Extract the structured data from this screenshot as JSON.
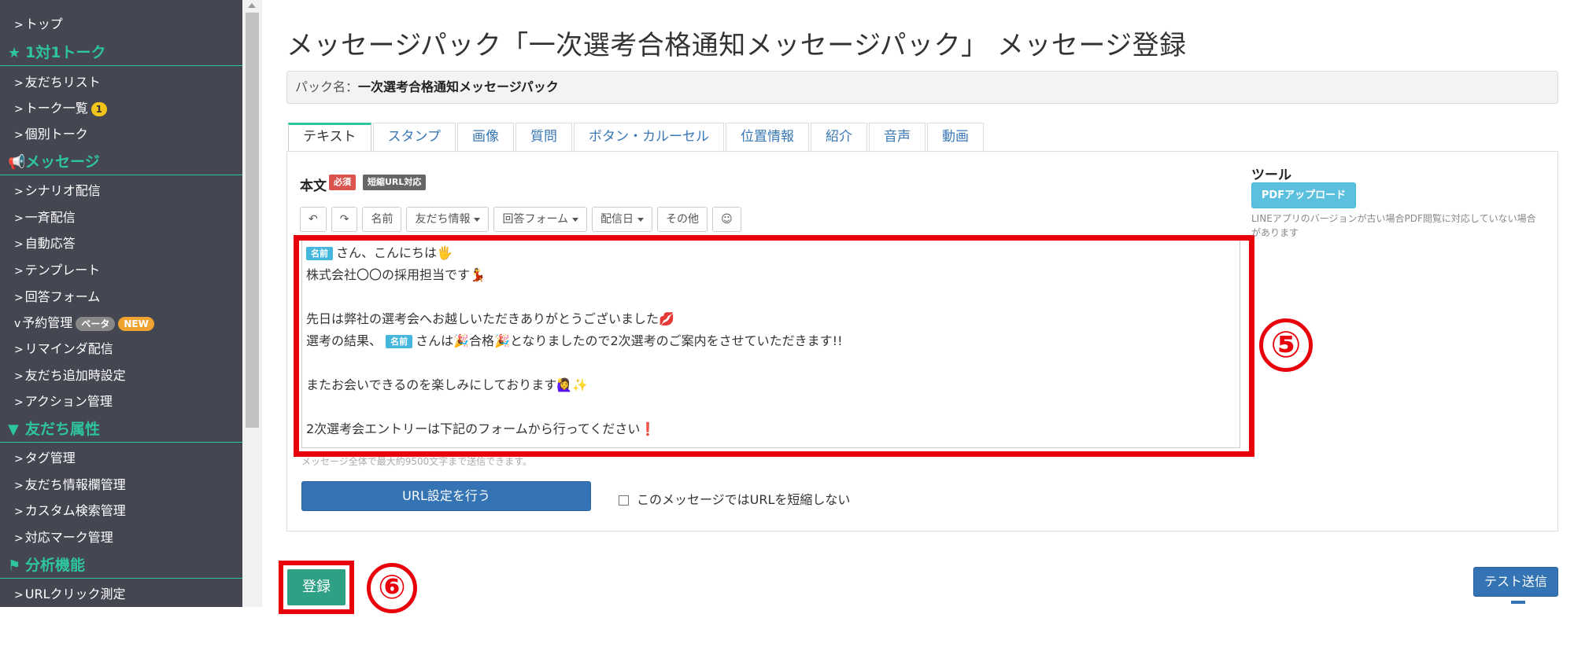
{
  "sidebar": {
    "top": "トップ",
    "talk_head": "1対1トーク",
    "friend_list": "友だちリスト",
    "talk_list": "トーク一覧",
    "talk_badge": "1",
    "individual_talk": "個別トーク",
    "message_head": "メッセージ",
    "scenario": "シナリオ配信",
    "broadcast": "一斉配信",
    "auto_reply": "自動応答",
    "template": "テンプレート",
    "answer_form": "回答フォーム",
    "reservation": "予約管理",
    "beta_badge": "ベータ",
    "new_badge": "NEW",
    "reminder": "リマインダ配信",
    "friend_add": "友だち追加時設定",
    "action": "アクション管理",
    "attr_head": "友だち属性",
    "tag": "タグ管理",
    "friend_info": "友だち情報欄管理",
    "custom_search": "カスタム検索管理",
    "mark": "対応マーク管理",
    "analysis_head": "分析機能",
    "url_click": "URLクリック測定"
  },
  "page": {
    "title": "メッセージパック「一次選考合格通知メッセージパック」 メッセージ登録",
    "pack_label": "パック名：",
    "pack_name": "一次選考合格通知メッセージパック"
  },
  "tabs": [
    "テキスト",
    "スタンプ",
    "画像",
    "質問",
    "ボタン・カルーセル",
    "位置情報",
    "紹介",
    "音声",
    "動画"
  ],
  "editor": {
    "body_label": "本文",
    "required_badge": "必須",
    "short_url_badge": "短縮URL対応",
    "toolbar": {
      "undo_icon": "↶",
      "redo_icon": "↷",
      "name": "名前",
      "friend_info": "友だち情報",
      "answer_form": "回答フォーム",
      "delivery_date": "配信日",
      "other": "その他",
      "emoji_icon": "☺"
    },
    "name_tag": "名前",
    "lines": {
      "l1": "さん、こんにちは🖐",
      "l2": "株式会社〇〇の採用担当です💃",
      "l4": "先日は弊社の選考会へお越しいただきありがとうございました💋",
      "l5a": "選考の結果、",
      "l5b": "さんは🎉合格🎉となりましたので2次選考のご案内をさせていただきます!!",
      "l7": "またお会いできるのを楽しみにしております🙋‍♀️✨",
      "l9": "2次選考会エントリーは下記のフォームから行ってください❗"
    },
    "char_note": "メッセージ全体で最大約9500文字まで送信できます。",
    "url_button": "URL設定を行う",
    "no_shorten": "このメッセージではURLを短縮しない"
  },
  "tools": {
    "title": "ツール",
    "pdf_button": "PDFアップロード",
    "note": "LINEアプリのバージョンが古い場合PDF閲覧に対応していない場合があります"
  },
  "annotations": {
    "mark5": "⑤",
    "mark6": "⑥"
  },
  "register_button": "登録",
  "test_send_button": "テスト送信"
}
